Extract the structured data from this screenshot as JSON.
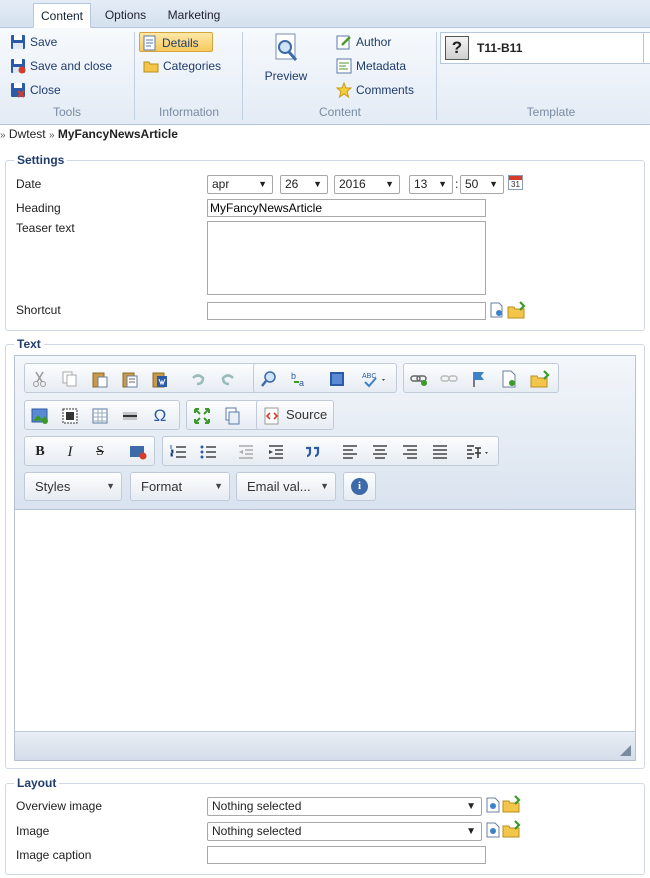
{
  "ribbon": {
    "tabs": [
      {
        "label": "Content",
        "active": true
      },
      {
        "label": "Options",
        "active": false
      },
      {
        "label": "Marketing",
        "active": false
      }
    ],
    "tools": {
      "save": "Save",
      "save_close": "Save and close",
      "close": "Close",
      "group": "Tools"
    },
    "information": {
      "details": "Details",
      "categories": "Categories",
      "group": "Information"
    },
    "content": {
      "preview": "Preview",
      "author": "Author",
      "metadata": "Metadata",
      "comments": "Comments",
      "group": "Content"
    },
    "template": {
      "name": "T11-B11",
      "icon_text": "?",
      "group": "Template"
    }
  },
  "breadcrumb": {
    "sep": "»",
    "parent": "Dwtest",
    "current": "MyFancyNewsArticle"
  },
  "settings": {
    "legend": "Settings",
    "date_label": "Date",
    "month": "apr",
    "day": "26",
    "year": "2016",
    "hour": "13",
    "time_sep": ":",
    "minute": "50",
    "calendar_day": "31",
    "heading_label": "Heading",
    "heading_value": "MyFancyNewsArticle",
    "teaser_label": "Teaser text",
    "teaser_value": "",
    "shortcut_label": "Shortcut",
    "shortcut_value": ""
  },
  "text": {
    "legend": "Text",
    "source_label": "Source",
    "styles_label": "Styles",
    "format_label": "Format",
    "email_label": "Email val...",
    "info_icon_text": "i",
    "omega": "Ω",
    "bold": "B",
    "italic": "I",
    "strike": "S"
  },
  "layout": {
    "legend": "Layout",
    "overview_label": "Overview image",
    "overview_value": "Nothing selected",
    "image_label": "Image",
    "image_value": "Nothing selected",
    "caption_label": "Image caption",
    "caption_value": ""
  },
  "colors": {
    "accent": "#1f3c6b",
    "ribbon_bg": "#e3ebf5",
    "selected": "#f7c95c"
  }
}
